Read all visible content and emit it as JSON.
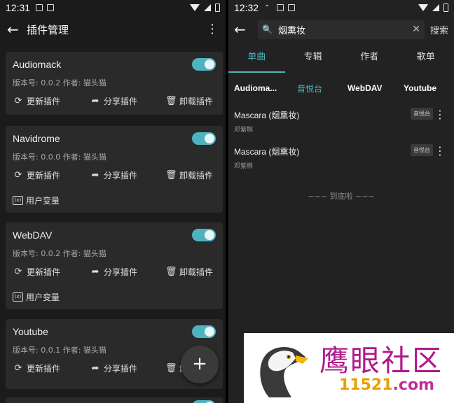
{
  "left": {
    "status_time": "12:31",
    "title": "插件管理",
    "cards": [
      {
        "name": "Audiomack",
        "meta": "版本号: 0.0.2   作者: 猫头猫",
        "update": "更新插件",
        "share": "分享插件",
        "uninstall": "卸载插件",
        "enabled": true
      },
      {
        "name": "Navidrome",
        "meta": "版本号: 0.0.0   作者: 猫头猫",
        "update": "更新插件",
        "share": "分享插件",
        "uninstall": "卸载插件",
        "vars": "用户变量",
        "enabled": true
      },
      {
        "name": "WebDAV",
        "meta": "版本号: 0.0.2   作者: 猫头猫",
        "update": "更新插件",
        "share": "分享插件",
        "uninstall": "卸载插件",
        "vars": "用户变量",
        "enabled": true
      },
      {
        "name": "Youtube",
        "meta": "版本号: 0.0.1   作者: 猫头猫",
        "update": "更新插件",
        "share": "分享插件",
        "uninstall": "卸",
        "enabled": true
      }
    ],
    "fab": "+"
  },
  "right": {
    "status_time": "12:32",
    "search_value": "烟熏妆",
    "search_button": "搜索",
    "tabs": [
      "单曲",
      "专辑",
      "作者",
      "歌单"
    ],
    "active_tab": "单曲",
    "plugin_tabs": [
      "Audioma...",
      "音悦台",
      "WebDAV",
      "Youtube"
    ],
    "active_plugin": "音悦台",
    "results": [
      {
        "title": "Mascara (烟熏妆)",
        "artist": "邓紫棋",
        "source": "音悦台"
      },
      {
        "title": "Mascara (烟熏妆)",
        "artist": "邓紫棋",
        "source": "音悦台"
      }
    ],
    "end_text": "~~~ 到底啦 ~~~"
  },
  "watermark": {
    "cn": "鹰眼社区",
    "url_num": "11521",
    "url_dom": ".com"
  },
  "colors": {
    "accent": "#4fb3bf",
    "background": "#1b1b1b",
    "card": "#2a2a2a"
  }
}
